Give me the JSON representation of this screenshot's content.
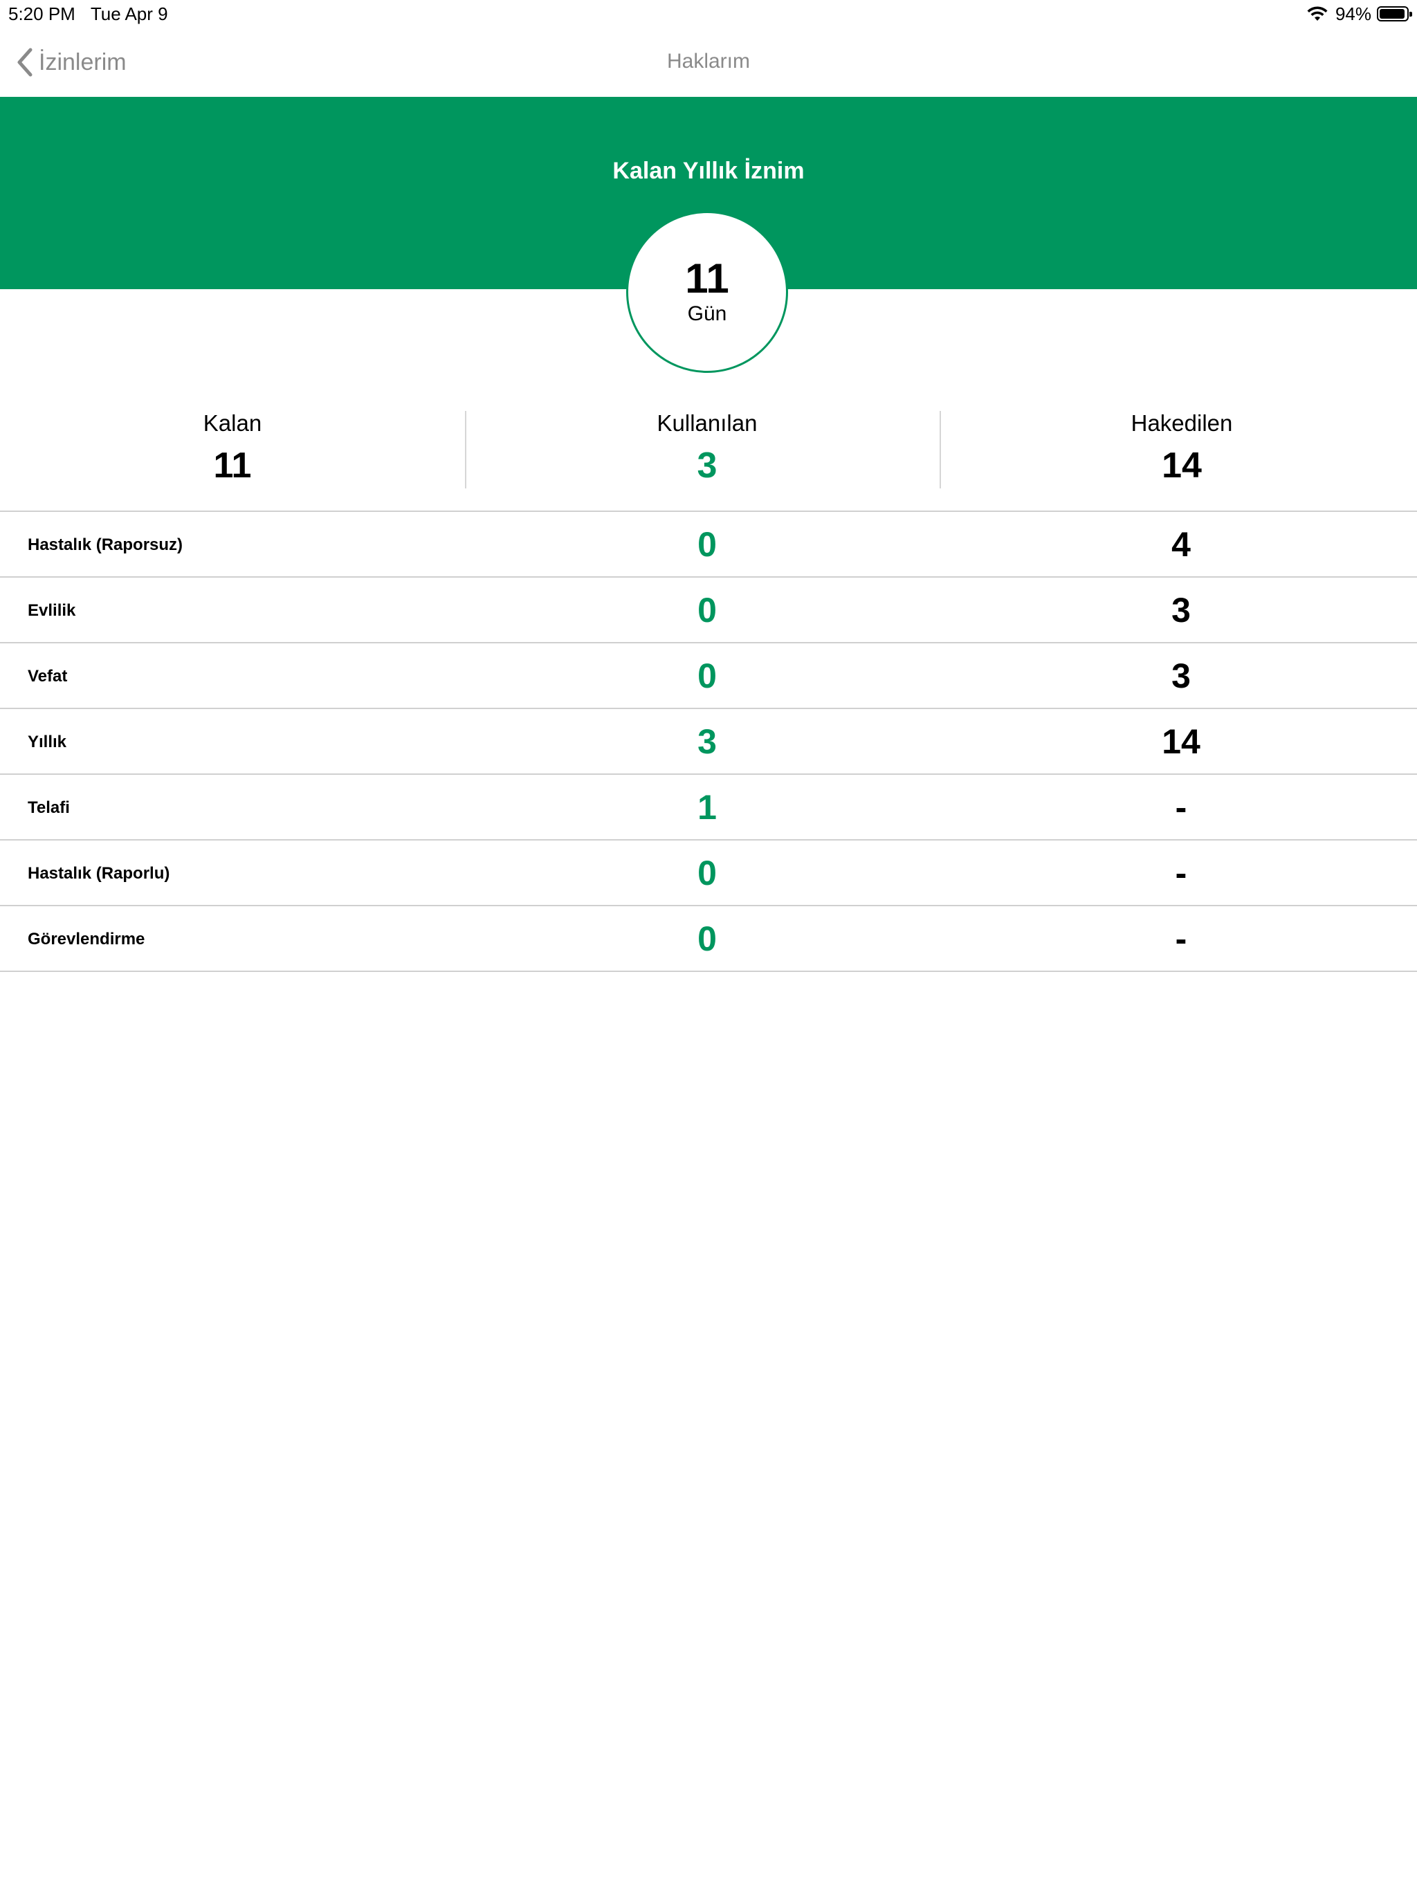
{
  "status_bar": {
    "time": "5:20 PM",
    "date": "Tue Apr 9",
    "battery_percent_label": "94%",
    "battery_level": 0.94
  },
  "nav": {
    "back_label": "İzinlerim",
    "title": "Haklarım"
  },
  "hero": {
    "title": "Kalan Yıllık İznim",
    "value": "11",
    "unit": "Gün"
  },
  "summary": {
    "remaining_label": "Kalan",
    "remaining_value": "11",
    "used_label": "Kullanılan",
    "used_value": "3",
    "earned_label": "Hakedilen",
    "earned_value": "14"
  },
  "rows": [
    {
      "label": "Hastalık (Raporsuz)",
      "used": "0",
      "earned": "4"
    },
    {
      "label": "Evlilik",
      "used": "0",
      "earned": "3"
    },
    {
      "label": "Vefat",
      "used": "0",
      "earned": "3"
    },
    {
      "label": "Yıllık",
      "used": "3",
      "earned": "14"
    },
    {
      "label": "Telafi",
      "used": "1",
      "earned": "-"
    },
    {
      "label": "Hastalık (Raporlu)",
      "used": "0",
      "earned": "-"
    },
    {
      "label": "Görevlendirme",
      "used": "0",
      "earned": "-"
    }
  ],
  "colors": {
    "accent": "#00965e",
    "muted": "#8a8a8a",
    "separator": "#d0d0d0"
  },
  "icons": {
    "back": "chevron-left-icon",
    "wifi": "wifi-icon",
    "battery": "battery-icon"
  }
}
